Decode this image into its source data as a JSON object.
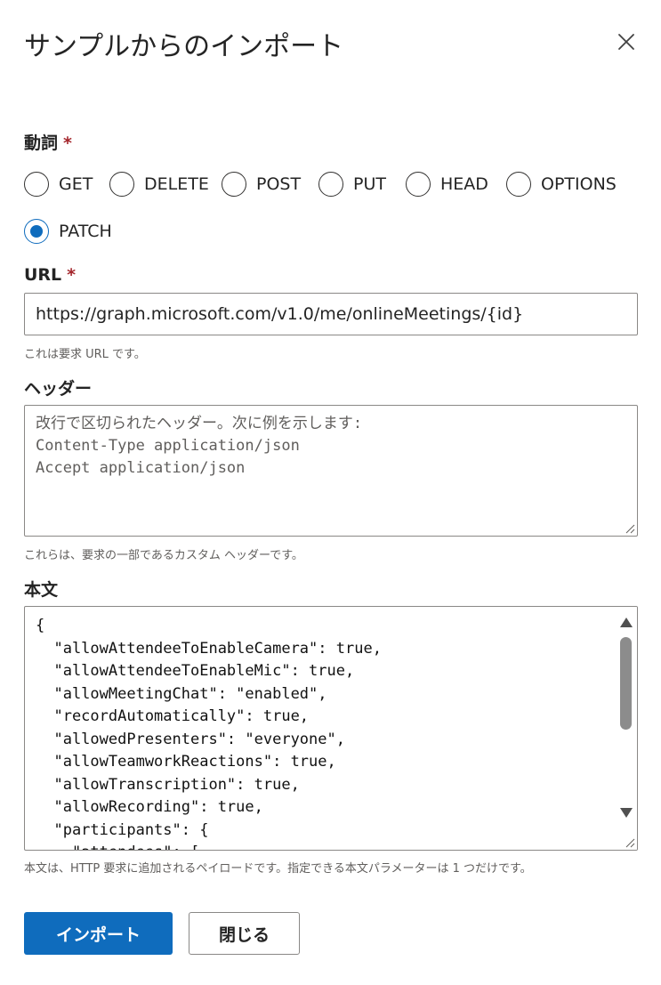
{
  "dialog": {
    "title": "サンプルからのインポート",
    "close_icon": "close-icon"
  },
  "verb": {
    "label": "動詞",
    "required_mark": "*",
    "options": [
      "GET",
      "DELETE",
      "POST",
      "PUT",
      "HEAD",
      "OPTIONS",
      "PATCH"
    ],
    "selected": "PATCH"
  },
  "url": {
    "label": "URL",
    "required_mark": "*",
    "value": "https://graph.microsoft.com/v1.0/me/onlineMeetings/{id}",
    "hint": "これは要求 URL です。"
  },
  "headers": {
    "label": "ヘッダー",
    "placeholder": "改行で区切られたヘッダー。次に例を示します:\nContent-Type application/json\nAccept application/json",
    "value": "",
    "hint": "これらは、要求の一部であるカスタム ヘッダーです。"
  },
  "body": {
    "label": "本文",
    "value": "{\n  \"allowAttendeeToEnableCamera\": true,\n  \"allowAttendeeToEnableMic\": true,\n  \"allowMeetingChat\": \"enabled\",\n  \"recordAutomatically\": true,\n  \"allowedPresenters\": \"everyone\",\n  \"allowTeamworkReactions\": true,\n  \"allowTranscription\": true,\n  \"allowRecording\": true,\n  \"participants\": {\n    \"attendees\": [",
    "hint": "本文は、HTTP 要求に追加されるペイロードです。指定できる本文パラメーターは 1 つだけです。"
  },
  "actions": {
    "import_label": "インポート",
    "close_label": "閉じる"
  },
  "colors": {
    "accent": "#0f6cbd",
    "required": "#a4262c"
  }
}
